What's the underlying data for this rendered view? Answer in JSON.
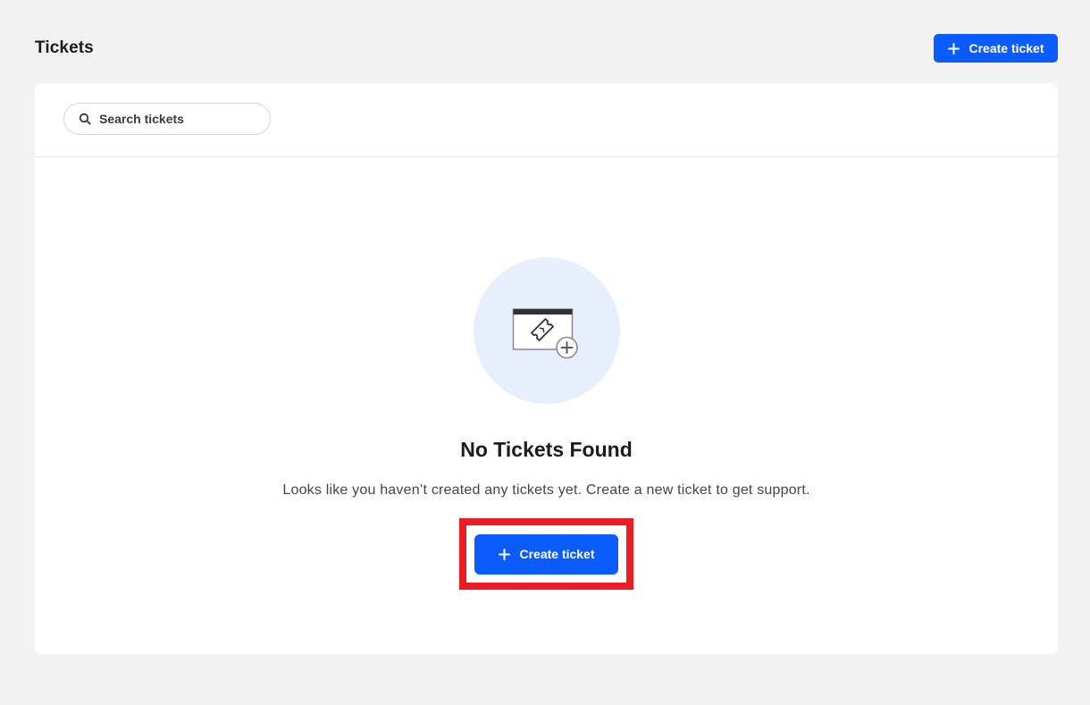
{
  "page": {
    "title": "Tickets"
  },
  "header": {
    "create_button_label": "Create ticket"
  },
  "search": {
    "placeholder": "Search tickets",
    "value": ""
  },
  "empty_state": {
    "title": "No Tickets Found",
    "description": "Looks like you haven’t created any tickets yet. Create a new ticket to get support.",
    "create_button_label": "Create ticket",
    "illustration_icon": "ticket-add-icon"
  },
  "colors": {
    "primary": "#0a5cff",
    "highlight": "#ec1c24",
    "page_background": "#f2f2f2",
    "illustration_background": "#e7effd"
  }
}
